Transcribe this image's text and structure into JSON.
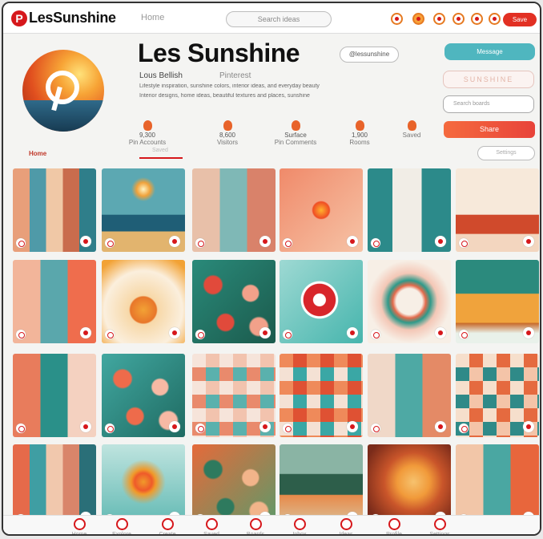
{
  "app": {
    "name": "LesSunshine",
    "logo_letter": "P"
  },
  "topbar": {
    "home": "Home",
    "search_placeholder": "Search ideas",
    "primary_button": "Save"
  },
  "profile": {
    "name": "Les Sunshine",
    "handle": "Lous Bellish",
    "link": "Pinterest",
    "bio_line_1": "Lifestyle inspiration, sunshine colors, interior ideas, and everyday beauty",
    "bio_line_2": "Interior designs, home ideas, beautiful textures and places, sunshine",
    "follow_label": "@lessunshine"
  },
  "actions": {
    "button_1": "Message",
    "button_2": "SUNSHINE",
    "input_placeholder": "Search boards",
    "button_3": "Share",
    "button_4": "Settings"
  },
  "stats": [
    {
      "value": "9,300",
      "label": "Pin Accounts"
    },
    {
      "value": "8,600",
      "label": "Visitors"
    },
    {
      "value": "Surface",
      "label": "Pin Comments"
    },
    {
      "value": "1,900",
      "label": "Rooms"
    },
    {
      "value": "",
      "label": "Saved"
    }
  ],
  "tabs": {
    "active": "Home",
    "secondary": "Saved"
  },
  "pins": [
    {
      "kind": "stripes",
      "colors": [
        "#e89f7a",
        "#4f9aa8",
        "#f0c8a6",
        "#c96c4d",
        "#2f7e8a"
      ]
    },
    {
      "kind": "sun-sea",
      "colors": [
        "#f0a23b",
        "#5ca8b2",
        "#1f5e76",
        "#e2b46e"
      ]
    },
    {
      "kind": "collage",
      "colors": [
        "#e8c0a9",
        "#7fb8b6",
        "#d9826a",
        "#f2e3d4"
      ]
    },
    {
      "kind": "orb",
      "colors": [
        "#f08a6a",
        "#f6c3a6",
        "#ffb32e",
        "#f04d24"
      ]
    },
    {
      "kind": "room-teal",
      "colors": [
        "#2c8a8a",
        "#f1ede6",
        "#c0532e",
        "#e9d3b8"
      ]
    },
    {
      "kind": "room-orange",
      "colors": [
        "#e86b3a",
        "#f3d6bf",
        "#d04a2c",
        "#f7e9da"
      ]
    },
    {
      "kind": "collage",
      "colors": [
        "#f2b59a",
        "#5aa7ac",
        "#ef6d4d",
        "#f4eadf"
      ]
    },
    {
      "kind": "sun-face",
      "colors": [
        "#f2a235",
        "#f7d8a8",
        "#e8762a",
        "#fbefdd"
      ]
    },
    {
      "kind": "flowers",
      "colors": [
        "#e14a3b",
        "#2a8a7a",
        "#f2a18a",
        "#1b5a4c"
      ]
    },
    {
      "kind": "pin-logo",
      "colors": [
        "#46b5ad",
        "#d8262b",
        "#ffffff",
        "#9ed9d3"
      ]
    },
    {
      "kind": "wreath",
      "colors": [
        "#f4c7b6",
        "#2e9a8a",
        "#e46a4b",
        "#f7efe6"
      ]
    },
    {
      "kind": "car",
      "colors": [
        "#2b8a7d",
        "#f0a33c",
        "#c86a2a",
        "#e9f1ea"
      ]
    },
    {
      "kind": "collage",
      "colors": [
        "#e87c5c",
        "#2a9089",
        "#f4d1c0",
        "#c94a34"
      ]
    },
    {
      "kind": "flowers",
      "colors": [
        "#ee6b4b",
        "#41a7a0",
        "#f7b9a4",
        "#1f6b62"
      ]
    },
    {
      "kind": "tiles",
      "colors": [
        "#f2c3ae",
        "#5ab1ad",
        "#e98a6c",
        "#f6e4da"
      ]
    },
    {
      "kind": "tiles",
      "colors": [
        "#df5133",
        "#3aa7a5",
        "#f4e1d4",
        "#ef8a5a"
      ]
    },
    {
      "kind": "collage",
      "colors": [
        "#f0d8c8",
        "#4ea9a4",
        "#e48a66",
        "#c75a38"
      ]
    },
    {
      "kind": "tiles",
      "colors": [
        "#e56a3f",
        "#f4c4a8",
        "#2f8a88",
        "#f6dfcc"
      ]
    },
    {
      "kind": "stripes",
      "colors": [
        "#e56a4a",
        "#3f9ea3",
        "#f1c8ad",
        "#d9856a",
        "#2a6f78"
      ]
    },
    {
      "kind": "sunburst",
      "colors": [
        "#f09a2a",
        "#5fb8b2",
        "#ef5a2a",
        "#bfe4df"
      ]
    },
    {
      "kind": "flowers",
      "colors": [
        "#2e7a5e",
        "#e56a3a",
        "#f2b48a",
        "#5c9a6a"
      ]
    },
    {
      "kind": "forest",
      "colors": [
        "#8ab4a4",
        "#e78a4a",
        "#2d5e4a",
        "#d9c7a3"
      ]
    },
    {
      "kind": "portrait",
      "colors": [
        "#f19a3a",
        "#7a2b1a",
        "#f6c26e",
        "#c9552a"
      ]
    },
    {
      "kind": "collage",
      "colors": [
        "#f2c6a8",
        "#4aa7a2",
        "#e8663c",
        "#f6e2d0"
      ]
    }
  ],
  "dock": [
    "Home",
    "Explore",
    "Create",
    "Saved",
    "Boards",
    "Inbox",
    "Ideas",
    "Profile",
    "Settings"
  ]
}
